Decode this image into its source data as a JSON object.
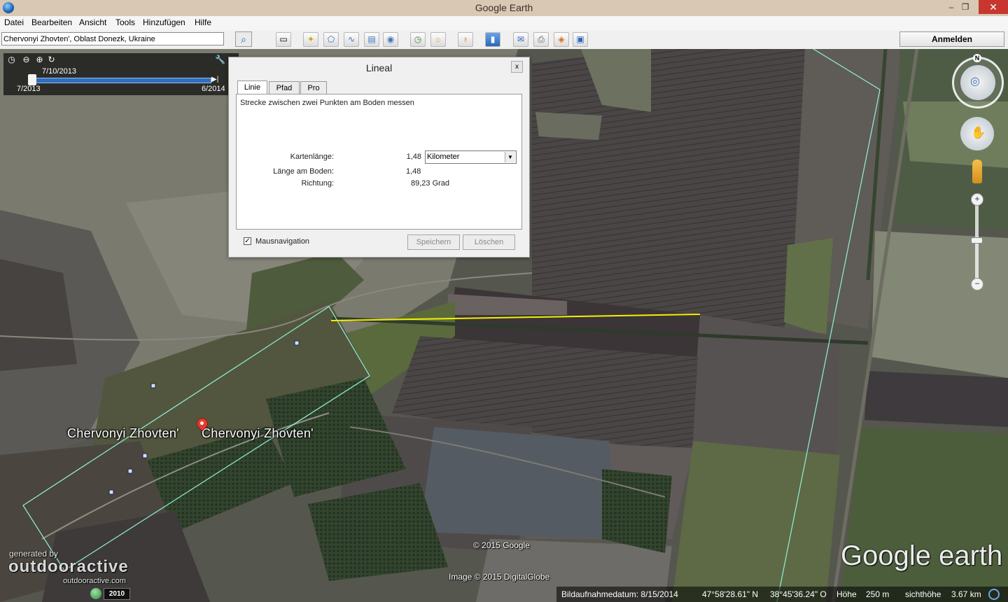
{
  "window": {
    "title": "Google Earth",
    "min": "–",
    "max": "❐",
    "close": "✕"
  },
  "menu": [
    "Datei",
    "Bearbeiten",
    "Ansicht",
    "Tools",
    "Hinzufügen",
    "Hilfe"
  ],
  "search": {
    "value": "Chervonyi Zhovten', Oblast Donezk, Ukraine",
    "button_icon": "search-icon"
  },
  "toolbar": {
    "icons": [
      "sidebar-toggle-icon",
      "placemark-icon",
      "polygon-icon",
      "path-icon",
      "image-overlay-icon",
      "tour-icon",
      "historical-imagery-icon",
      "sunlight-icon",
      "planets-icon",
      "ruler-icon",
      "email-icon",
      "print-icon",
      "maps-icon",
      "save-image-icon"
    ],
    "login": "Anmelden"
  },
  "timeslider": {
    "current": "7/10/2013",
    "start": "7/2013",
    "end": "6/2014"
  },
  "ruler": {
    "title": "Lineal",
    "close": "x",
    "tabs": [
      "Linie",
      "Pfad",
      "Pro"
    ],
    "description": "Strecke zwischen zwei Punkten am Boden messen",
    "map_length_label": "Kartenlänge:",
    "map_length_value": "1,48",
    "unit": "Kilometer",
    "ground_length_label": "Länge am Boden:",
    "ground_length_value": "1,48",
    "heading_label": "Richtung:",
    "heading_value": "89,23 Grad",
    "mouse_nav_label": "Mausnavigation",
    "mouse_nav_checked": "✓",
    "save_button": "Speichern",
    "clear_button": "Löschen"
  },
  "placemark": {
    "label_left": "Chervonyi Zhovten'",
    "label_right": "Chervonyi Zhovten'"
  },
  "navigation": {
    "north": "N",
    "zoom_in": "+",
    "zoom_out": "−"
  },
  "overlays": {
    "generated_by": "generated by",
    "brand": "outdooractive",
    "brand_url": "outdooractive.com",
    "copyright_google": "© 2015 Google",
    "copyright_imagery": "Image © 2015 DigitalGlobe",
    "logo": "Google earth",
    "year": "2010"
  },
  "status": {
    "imagery_date_label": "Bildaufnahmedatum: 8/15/2014",
    "lat": "47°58'28.61\" N",
    "lon": "38°45'36.24\" O",
    "elevation_label": "Höhe",
    "elevation_value": "250 m",
    "eye_alt_label": "sichthöhe",
    "eye_alt_value": "3.67 km"
  }
}
